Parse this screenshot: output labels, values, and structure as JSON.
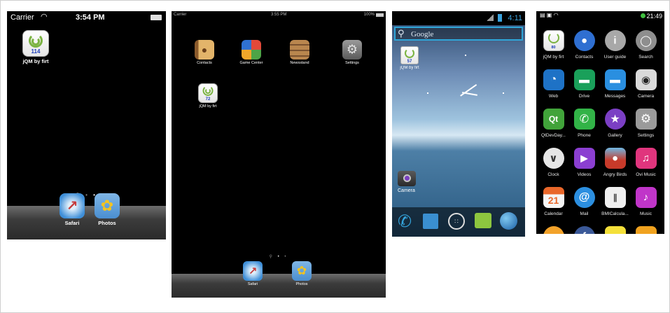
{
  "iphone": {
    "status": {
      "carrier": "Carrier",
      "time": "3:54 PM"
    },
    "apps": [
      {
        "label": "jQM by firt",
        "badge": "114"
      }
    ],
    "dock": [
      {
        "label": "Safari"
      },
      {
        "label": "Photos"
      }
    ]
  },
  "ipad": {
    "status": {
      "carrier": "Carrier",
      "time": "3:55 PM",
      "battery": "100%"
    },
    "apps": [
      {
        "label": "Contacts"
      },
      {
        "label": "Game Center"
      },
      {
        "label": "Newsstand"
      },
      {
        "label": "Settings"
      },
      {
        "label": "jQM by firt",
        "badge": "72"
      }
    ],
    "dock": [
      {
        "label": "Safari"
      },
      {
        "label": "Photos"
      }
    ]
  },
  "android": {
    "status": {
      "time": "4:11"
    },
    "search_placeholder": "Google",
    "apps": [
      {
        "label": "jQM by firt",
        "badge": "57"
      },
      {
        "label": "Camera"
      }
    ]
  },
  "nokia": {
    "status": {
      "time": "21:49"
    },
    "apps": [
      {
        "label": "jQM by firt",
        "badge": "80",
        "color": "#f3f3f3"
      },
      {
        "label": "Contacts",
        "color": "#2f6fd1"
      },
      {
        "label": "User guide",
        "color": "#a8a8a8"
      },
      {
        "label": "Search",
        "color": "#8e8e8e"
      },
      {
        "label": "Web",
        "color": "#1e72c6"
      },
      {
        "label": "Drive",
        "color": "#1aa05a"
      },
      {
        "label": "Messages",
        "color": "#2a8fe0"
      },
      {
        "label": "Camera",
        "color": "#d9d9d9"
      },
      {
        "label": "QtDevDay...",
        "color": "#41a33a"
      },
      {
        "label": "Phone",
        "color": "#32b347"
      },
      {
        "label": "Gallery",
        "color": "#7b3fc4"
      },
      {
        "label": "Settings",
        "color": "#9a9a9a"
      },
      {
        "label": "Clock",
        "color": "#e6e6e6"
      },
      {
        "label": "Videos",
        "color": "#8b3fd1"
      },
      {
        "label": "Angry Birds",
        "color": "#c73a2a"
      },
      {
        "label": "Ovi Music",
        "color": "#e0357d"
      },
      {
        "label": "Calendar",
        "color": "#e9672a"
      },
      {
        "label": "Mail",
        "color": "#2c8fe0"
      },
      {
        "label": "BMICalcula...",
        "color": "#efefef"
      },
      {
        "label": "Music",
        "color": "#c035c9"
      },
      {
        "label": "",
        "color": "#f2a22a"
      },
      {
        "label": "",
        "color": "#3b5998"
      },
      {
        "label": "",
        "color": "#f4e03a"
      },
      {
        "label": "",
        "color": "#f0a21f"
      }
    ]
  }
}
